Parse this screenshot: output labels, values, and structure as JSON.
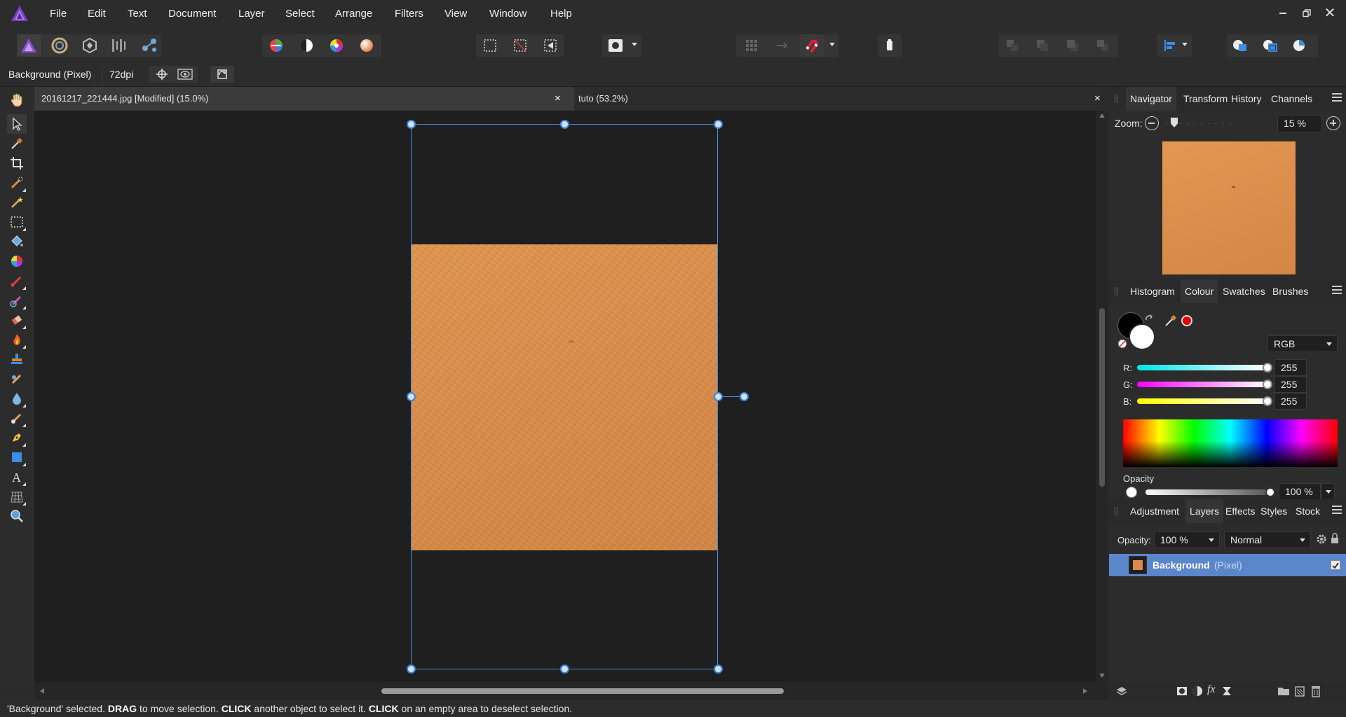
{
  "menubar": {
    "items": [
      "File",
      "Edit",
      "Text",
      "Document",
      "Layer",
      "Select",
      "Arrange",
      "Filters",
      "View",
      "Window",
      "Help"
    ],
    "window_controls": [
      "minimize",
      "restore",
      "close"
    ]
  },
  "context": {
    "layer_name": "Background (Pixel)",
    "dpi": "72dpi"
  },
  "tabs": {
    "doc1": "20161217_221444.jpg [Modified] (15.0%)",
    "doc2": "tuto (53.2%)",
    "close_glyph": "×"
  },
  "navigator": {
    "tabs": [
      "Navigator",
      "Transform",
      "History",
      "Channels"
    ],
    "zoom_label": "Zoom:",
    "zoom_value": "15 %"
  },
  "colour_panel": {
    "tabs": [
      "Histogram",
      "Colour",
      "Swatches",
      "Brushes"
    ],
    "mode": "RGB",
    "channels": [
      {
        "label": "R:",
        "value": "255",
        "color": "#00e5e5"
      },
      {
        "label": "G:",
        "value": "255",
        "color": "#ff00ff"
      },
      {
        "label": "B:",
        "value": "255",
        "color": "#ffff00"
      }
    ],
    "opacity_label": "Opacity",
    "opacity_value": "100 %",
    "primary_color": "#000000",
    "secondary_color": "#ffffff",
    "extra_swatch": "#e00000"
  },
  "layers_panel": {
    "tabs": [
      "Adjustment",
      "Layers",
      "Effects",
      "Styles",
      "Stock"
    ],
    "opacity_label": "Opacity:",
    "opacity_value": "100 %",
    "blend_mode": "Normal",
    "layer": {
      "name": "Background",
      "type": "(Pixel)",
      "visible": true,
      "thumb_color": "#d98b4b"
    }
  },
  "canvas": {
    "image_color": "#d98b4b",
    "selection_color": "#4a90e2"
  },
  "status": {
    "parts": [
      {
        "t": "'Background' selected. ",
        "b": false
      },
      {
        "t": "DRAG",
        "b": true
      },
      {
        "t": " to move selection. ",
        "b": false
      },
      {
        "t": "CLICK",
        "b": true
      },
      {
        "t": " another object to select it. ",
        "b": false
      },
      {
        "t": "CLICK",
        "b": true
      },
      {
        "t": " on an empty area to deselect selection.",
        "b": false
      }
    ]
  }
}
